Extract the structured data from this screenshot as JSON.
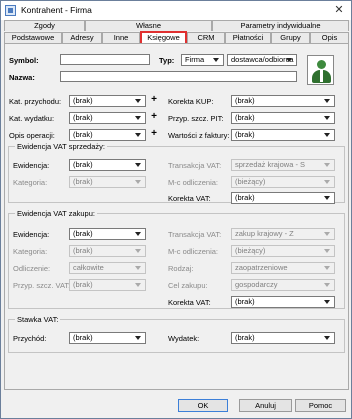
{
  "window": {
    "title": "Kontrahent - Firma",
    "close_label": "✕"
  },
  "tabs_row1": [
    {
      "label": "Zgody"
    },
    {
      "label": "Własne"
    },
    {
      "label": "Parametry indywidualne"
    }
  ],
  "tabs_row2": [
    {
      "label": "Podstawowe"
    },
    {
      "label": "Adresy"
    },
    {
      "label": "Inne"
    },
    {
      "label": "Księgowe",
      "active": true
    },
    {
      "label": "CRM"
    },
    {
      "label": "Płatności"
    },
    {
      "label": "Grupy"
    },
    {
      "label": "Opis"
    }
  ],
  "header": {
    "symbol_label": "Symbol:",
    "symbol_value": "",
    "typ_label": "Typ:",
    "typ_value": "Firma",
    "typ2_value": "dostawca/odbiorca",
    "nazwa_label": "Nazwa:",
    "nazwa_value": ""
  },
  "accounts": {
    "kat_przychodu_label": "Kat. przychodu:",
    "kat_przychodu_value": "(brak)",
    "kat_wydatku_label": "Kat. wydatku:",
    "kat_wydatku_value": "(brak)",
    "opis_operacji_label": "Opis operacji:",
    "opis_operacji_value": "(brak)",
    "korekta_kup_label": "Korekta KUP:",
    "korekta_kup_value": "(brak)",
    "przyp_pit_label": "Przyp. szcz. PIT:",
    "przyp_pit_value": "(brak)",
    "wartosci_faktury_label": "Wartości z faktury:",
    "wartosci_faktury_value": "(brak)",
    "plus": "+"
  },
  "vat_sales": {
    "legend": "Ewidencja VAT sprzedaży:",
    "ewidencja_label": "Ewidencja:",
    "ewidencja_value": "(brak)",
    "kategoria_label": "Kategoria:",
    "kategoria_value": "(brak)",
    "transakcja_label": "Transakcja VAT:",
    "transakcja_value": "sprzedaż krajowa - S",
    "mc_label": "M-c odliczenia:",
    "mc_value": "(bieżący)",
    "korekta_label": "Korekta VAT:",
    "korekta_value": "(brak)"
  },
  "vat_purchase": {
    "legend": "Ewidencja VAT zakupu:",
    "ewidencja_label": "Ewidencja:",
    "ewidencja_value": "(brak)",
    "kategoria_label": "Kategoria:",
    "kategoria_value": "(brak)",
    "odliczenie_label": "Odliczenie:",
    "odliczenie_value": "całkowite",
    "przyp_label": "Przyp. szcz. VAT:",
    "przyp_value": "(brak)",
    "transakcja_label": "Transakcja VAT:",
    "transakcja_value": "zakup krajowy - Z",
    "mc_label": "M-c odliczenia:",
    "mc_value": "(bieżący)",
    "rodzaj_label": "Rodzaj:",
    "rodzaj_value": "zaopatrzeniowe",
    "cel_label": "Cel zakupu:",
    "cel_value": "gospodarczy",
    "korekta_label": "Korekta VAT:",
    "korekta_value": "(brak)"
  },
  "stawka": {
    "legend": "Stawka VAT:",
    "przychod_label": "Przychód:",
    "przychod_value": "(brak)",
    "wydatek_label": "Wydatek:",
    "wydatek_value": "(brak)"
  },
  "buttons": {
    "ok": "OK",
    "cancel": "Anuluj",
    "help": "Pomoc"
  }
}
